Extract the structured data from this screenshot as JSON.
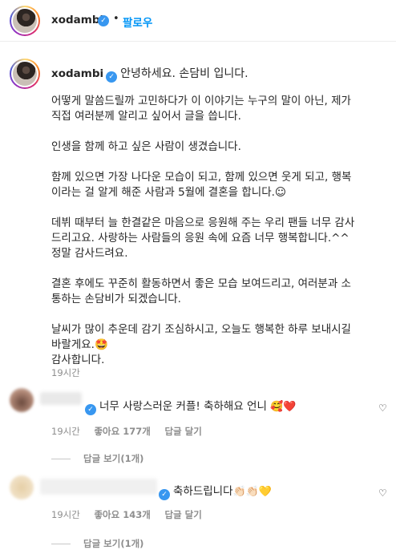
{
  "header": {
    "username": "xodambi",
    "separator": "•",
    "follow_label": "팔로우"
  },
  "caption": {
    "username": "xodambi",
    "greeting": "안녕하세요. 손담비 입니다.",
    "paragraphs": [
      "어떻게 말씀드릴까 고민하다가 이 이야기는 누구의 말이 아닌, 제가\n직접 여러분께 알리고 싶어서 글을 씁니다.",
      "인생을 함께 하고 싶은 사람이 생겼습니다.",
      "함께 있으면 가장 나다운 모습이 되고, 함께 있으면 웃게 되고, 행복\n이라는 걸 알게 해준 사람과 5월에 결혼을 합니다.☺",
      "데뷔 때부터 늘 한결같은 마음으로 응원해 주는 우리 팬들 너무 감사\n드리고요. 사랑하는 사람들의 응원 속에 요즘 너무 행복합니다.^^\n정말 감사드려요.",
      "결혼 후에도 꾸준히 활동하면서 좋은 모습 보여드리고, 여러분과 소\n통하는 손담비가 되겠습니다.",
      "날씨가 많이 추운데 감기 조심하시고, 오늘도 행복한 하루 보내시길\n바랄게요.🤩\n감사합니다."
    ],
    "time": "19시간"
  },
  "comments": [
    {
      "text": "너무 사랑스러운 커플! 축하해요 언니",
      "emojis": "🥰❤️",
      "time": "19시간",
      "likes": "좋아요 177개",
      "reply_label": "답글 달기",
      "view_replies": "답글 보기(1개)"
    },
    {
      "text": "축하드립니다",
      "emojis": "👏🏻👏🏻💛",
      "time": "19시간",
      "likes": "좋아요 143개",
      "reply_label": "답글 달기",
      "view_replies": "답글 보기(1개)"
    }
  ],
  "colors": {
    "accent": "#0095f6",
    "verified": "#3897f0",
    "muted": "#8e8e8e"
  },
  "icons": {
    "verified": "verified-badge-icon",
    "like": "heart-outline-icon"
  }
}
